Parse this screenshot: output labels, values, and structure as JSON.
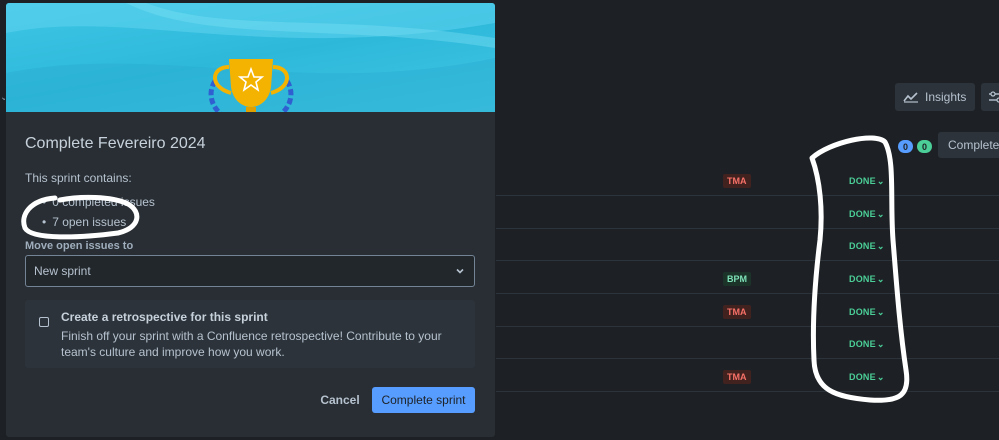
{
  "modal": {
    "title": "Complete Fevereiro 2024",
    "contains_label": "This sprint contains:",
    "completed_issues": "0 completed issues",
    "open_issues": "7 open issues",
    "move_label": "Move open issues to",
    "select_value": "New sprint",
    "retro_title": "Create a retrospective for this sprint",
    "retro_desc": "Finish off your sprint with a Confluence retrospective! Contribute to your team's culture and improve how you work.",
    "cancel_label": "Cancel",
    "primary_label": "Complete sprint"
  },
  "board": {
    "insights_label": "Insights",
    "complete_label": "Complete",
    "counter_blue": "0",
    "counter_green": "0",
    "rows": [
      {
        "label": "TMA",
        "label_color": "red",
        "status": "DONE"
      },
      {
        "label": "",
        "label_color": "",
        "status": "DONE"
      },
      {
        "label": "",
        "label_color": "",
        "status": "DONE"
      },
      {
        "label": "BPM",
        "label_color": "green",
        "status": "DONE"
      },
      {
        "label": "TMA",
        "label_color": "red",
        "status": "DONE"
      },
      {
        "label": "",
        "label_color": "",
        "status": "DONE"
      },
      {
        "label": "TMA",
        "label_color": "red",
        "status": "DONE"
      }
    ]
  },
  "colors": {
    "primary": "#579dff",
    "done": "#4bce97",
    "hero": "#3fc6e5",
    "trophy": "#f5b301",
    "laurel": "#2f5fd0"
  }
}
